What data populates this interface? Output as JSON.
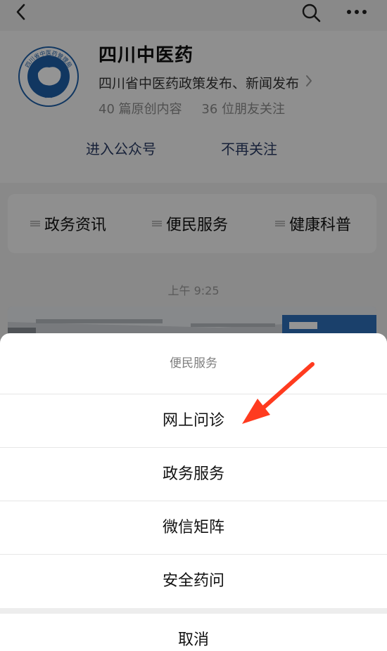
{
  "account": {
    "name": "四川中医药",
    "description": "四川省中医药政策发布、新闻发布",
    "original_count_text": "40 篇原创内容",
    "followers_text": "36 位朋友关注",
    "logo_text": "四川省中医药管理局"
  },
  "actions": {
    "enter_label": "进入公众号",
    "unfollow_label": "不再关注"
  },
  "menu": {
    "items": [
      {
        "label": "政务资讯"
      },
      {
        "label": "便民服务"
      },
      {
        "label": "健康科普"
      }
    ]
  },
  "chat": {
    "time": "上午 9:25"
  },
  "sheet": {
    "title": "便民服务",
    "options": [
      {
        "label": "网上问诊"
      },
      {
        "label": "政务服务"
      },
      {
        "label": "微信矩阵"
      },
      {
        "label": "安全药问"
      }
    ],
    "cancel_label": "取消"
  },
  "icons": [
    "back-icon",
    "search-icon",
    "more-icon",
    "chevron-right-icon",
    "menu-lines-icon",
    "arrow-annotation"
  ],
  "colors": {
    "accent_link": "#2a3b64",
    "logo_blue": "#1e5fa8",
    "annotation_red": "#ff3b1f"
  }
}
